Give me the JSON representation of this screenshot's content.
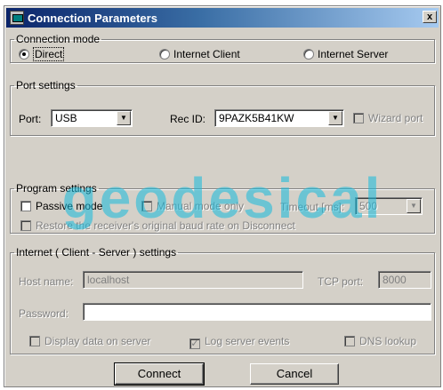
{
  "window": {
    "title": "Connection Parameters",
    "close_glyph": "x"
  },
  "connection_mode": {
    "legend": "Connection mode",
    "options": [
      {
        "label": "Direct",
        "selected": true
      },
      {
        "label": "Internet Client",
        "selected": false
      },
      {
        "label": "Internet Server",
        "selected": false
      }
    ]
  },
  "port_settings": {
    "legend": "Port settings",
    "port_label": "Port:",
    "port_value": "USB",
    "rec_id_label": "Rec ID:",
    "rec_id_value": "9PAZK5B41KW",
    "wizard_port_label": "Wizard port",
    "wizard_port_checked": false
  },
  "program_settings": {
    "legend": "Program settings",
    "passive_mode_label": "Passive mode",
    "passive_mode_checked": false,
    "manual_mode_label": "Manual mode only",
    "timeout_label": "Timeout [ms]:",
    "timeout_value": "500",
    "restore_baud_label": "Restore the receiver's original baud rate on Disconnect"
  },
  "internet_settings": {
    "legend": "Internet ( Client - Server ) settings",
    "host_label": "Host name:",
    "host_value": "localhost",
    "tcp_port_label": "TCP port:",
    "tcp_port_value": "8000",
    "password_label": "Password:",
    "password_value": "",
    "display_data_label": "Display data on server",
    "log_events_label": "Log server events",
    "log_events_checked": true,
    "dns_lookup_label": "DNS lookup"
  },
  "buttons": {
    "connect": "Connect",
    "cancel": "Cancel"
  },
  "watermark": {
    "text": "geodesical"
  },
  "colors": {
    "watermark": "#14b9dc",
    "titlebar": "#0a246a",
    "face": "#d4d0c8"
  },
  "icons": {
    "title": "connection-app-icon",
    "close": "close-icon",
    "dropdown": "chevron-down-icon"
  }
}
